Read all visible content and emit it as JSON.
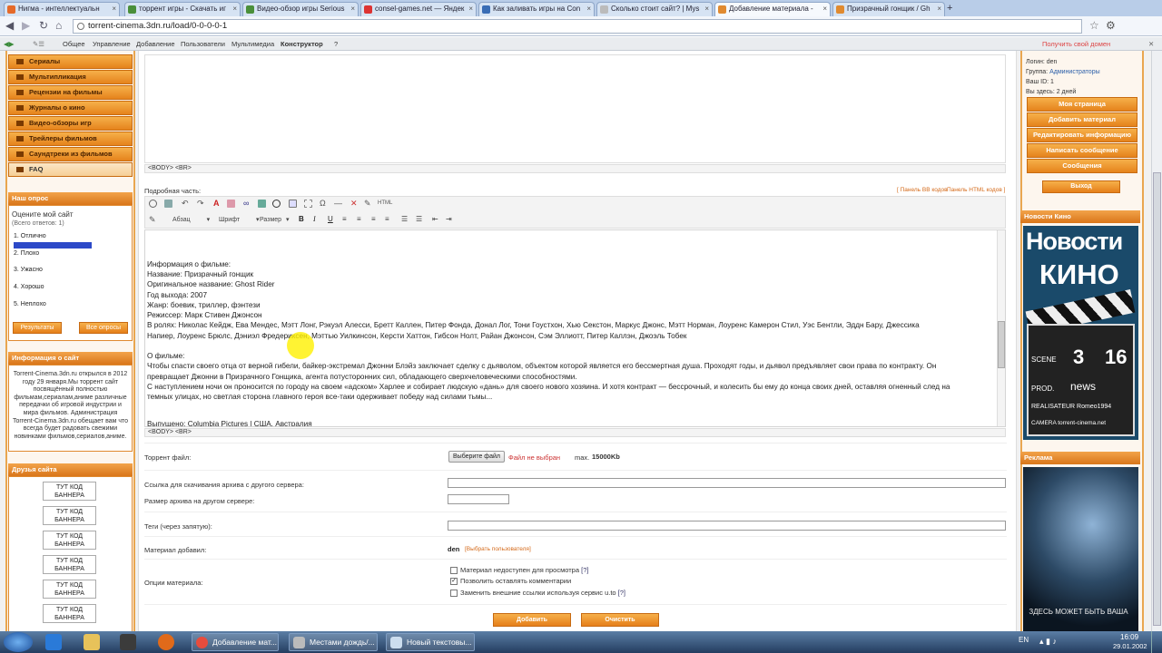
{
  "browser": {
    "tabs": [
      {
        "label": "Нигма - интеллектуальн"
      },
      {
        "label": "торрент игры - Скачать иг"
      },
      {
        "label": "Видео-обзор игры Serious"
      },
      {
        "label": "consel-games.net — Яндек"
      },
      {
        "label": "Как заливать игры на Con"
      },
      {
        "label": "Сколько стоит сайт? | Mys"
      },
      {
        "label": "Добавление материала - "
      },
      {
        "label": "Призрачный гонщик / Gh"
      }
    ],
    "new_tab": "+",
    "url": "torrent-cinema.3dn.ru/load/0-0-0-0-1"
  },
  "ucoz_bar": {
    "items": [
      "Общее",
      "Управление",
      "Добавление",
      "Пользователи",
      "Мультимедиа",
      "Конструктор",
      "?"
    ],
    "right_link": "Получить свой домен"
  },
  "left_menu": [
    "Сериалы",
    "Мультипликация",
    "Рецензии на фильмы",
    "Журналы о кино",
    "Видео-обзоры игр",
    "Трейлеры фильмов",
    "Саундтреки из фильмов",
    "FAQ"
  ],
  "poll": {
    "title": "Наш опрос",
    "question": "Оцените мой сайт",
    "total": "(Всего ответов: 1)",
    "options": [
      "1. Отлично",
      "2. Плохо",
      "3. Ужасно",
      "4. Хорошо",
      "5. Неплохо"
    ],
    "results_button": "Результаты",
    "all_polls_button": "Все опросы",
    "votes_fraction": [
      1,
      0,
      0,
      0,
      0
    ]
  },
  "site_info": {
    "title": "Информация о сайт",
    "text": "Torrent-Cinema.3dn.ru открылся в 2012 году 29 января.Мы торрент сайт посвящённый полностью фильмам,сериалам,аниме различные передачки об игровой индустрии и мира фильмов. Администрация Torrent-Cinema.3dn.ru обещает вам что всегда будет радовать свежими новинками фильмов,сериалов,аниме."
  },
  "friends": {
    "title": "Друзья сайта",
    "banner_line1": "ТУТ КОД",
    "banner_line2": "БАННЕРА"
  },
  "form": {
    "path_top": "<BODY>  <BR>",
    "detail_label": "Подробная часть:",
    "panel_bb": "[ Панель BB кодов",
    "panel_html": "Панель HTML кодов ]",
    "para_select": "Абзац",
    "font_select": "Шрифт",
    "size_select": "Размер",
    "editor_lines": [
      "Информация о фильме:",
      "Название: Призрачный гонщик",
      "Оригинальное название: Ghost Rider",
      "Год выхода: 2007",
      "Жанр: боевик, триллер, фэнтези",
      "Режиссер: Марк Стивен Джонсон",
      "В ролях: Николас Кейдж, Ева Мендес, Мэтт Лонг, Рэкуэл Алесси, Бретт Каллен, Питер Фонда, Донал Лог, Тони Гоустхон, Хью Секстон, Маркус Джонс, Мэтт Норман, Лоуренс Камерон Стил, Уэс Бентли, Эддн Бару, Джессика",
      "Напиер, Лоуренс Брюлс, Дэниэл Фредериксен, Мэттью Уилкинсон, Керсти Хаттон, Гибсон Нолт, Райан Джонсон, Сэм Эллиотт, Питер Каллэн, Джоэль Тобек",
      "",
      "О фильме:",
      "Чтобы спасти своего отца от верной гибели, байкер-экстремал Джонни Блэйз заключает сделку с дьяволом, объектом которой является его бессмертная душа. Проходят годы, и дьявол предъявляет свои права по контракту. Он",
      "превращает Джонни в Призрачного Гонщика, агента потусторонних сил, обладающего сверхчеловеческими способностями.",
      "С наступлением ночи он проносится по городу на своем «адском» Харлее и собирает людскую «дань» для своего нового хозяина. И хотя контракт — бессрочный, и колесить бы ему до конца своих дней, оставляя огненный след на",
      "темных улицах, но светлая сторона главного героя все-таки одерживает победу над силами тьмы...",
      "",
      "Выпущено: Columbia Pictures  |  США, Австралия"
    ],
    "path_bottom": "<BODY>  <BR>",
    "torrent_label": "Торрент файл:",
    "choose_file": "Выберите файл",
    "no_file": "Файл не выбран",
    "max_label": "max.",
    "max_value": "15000Kb",
    "link_label": "Ссылка для скачивания архива с другого сервера:",
    "size_label": "Размер архива на другом сервере:",
    "tags_label": "Теги (через запятую):",
    "added_by_label": "Материал добавил:",
    "added_by_value": "den",
    "choose_user": "[Выбрать пользователя]",
    "options_label": "Опции материала:",
    "options": [
      {
        "label": "Материал недоступен для просмотра",
        "suffix": "[?]",
        "checked": false
      },
      {
        "label": "Позволить оставлять комментарии",
        "suffix": "",
        "checked": true
      },
      {
        "label": "Заменить внешние ссылки используя сервис u.to",
        "suffix": "[?]",
        "checked": false
      }
    ],
    "submit": "Добавить",
    "reset": "Очистить"
  },
  "user_panel": {
    "login": "Логин: den",
    "group_label": "Группа:",
    "group_value": "Администраторы",
    "id": "Ваш ID: 1",
    "here": "Вы здесь: 2 дней",
    "menu": [
      "Моя страница",
      "Добавить материал",
      "Редактировать информацию",
      "Написать сообщение",
      "Сообщения"
    ],
    "logout": "Выход"
  },
  "cinema_news": {
    "title": "Новости Кино",
    "big1": "Новости",
    "big2": "КИНО",
    "scene": "SCENE",
    "num1": "3",
    "num2": "16",
    "prod": "PROD.",
    "news": "news",
    "real": "REALISATEUR Romeo1994",
    "camera": "CAMERA torrent-cinema.net"
  },
  "ad": {
    "title": "Реклама",
    "text": "ЗДЕСЬ МОЖЕТ БЫТЬ ВАША"
  },
  "taskbar": {
    "items": [
      "Добавление мат...",
      "Местами дождь/...",
      "Новый текстовы..."
    ],
    "lang": "EN",
    "time": "16:09",
    "date": "29.01.2002"
  }
}
